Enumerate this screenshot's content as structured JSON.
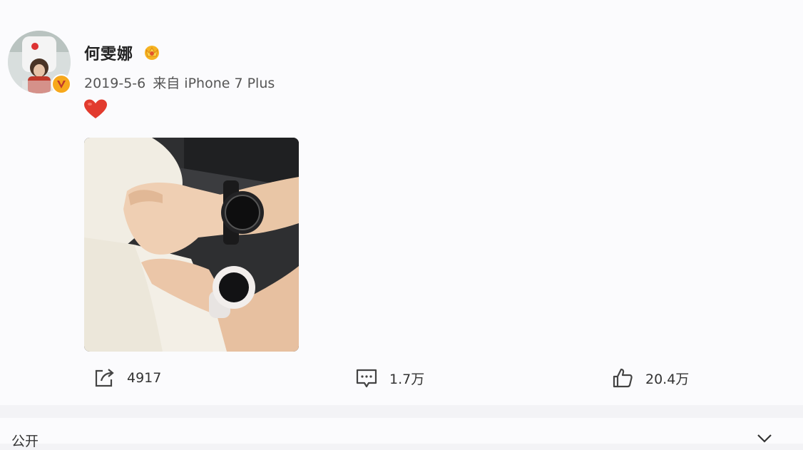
{
  "post": {
    "author": {
      "name": "何雯娜",
      "avatar_icon": "user-avatar",
      "verified_icon": "verified-v-icon",
      "member_icon": "crown-member-icon"
    },
    "meta": {
      "date": "2019-5-6",
      "source": "来自 iPhone 7 Plus"
    },
    "content": {
      "emoji_icon": "red-heart-icon",
      "image_icon": "photo-hands-watches"
    },
    "actions": {
      "repost_count": "4917",
      "comment_count": "1.7万",
      "like_count": "20.4万"
    }
  },
  "footer": {
    "label": "公开"
  },
  "colors": {
    "verified": "#f7a81c",
    "heart": "#e23b2e",
    "text_primary": "#222222",
    "text_secondary": "#555555"
  }
}
